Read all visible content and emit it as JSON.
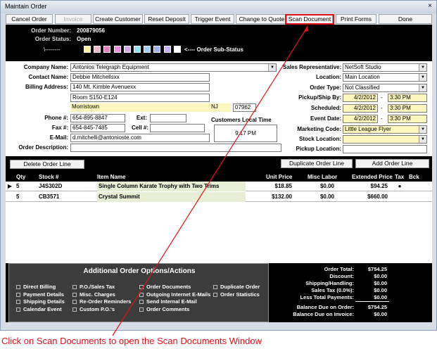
{
  "window": {
    "title": "Maintain  Order",
    "close_glyph": "×"
  },
  "toolbar": {
    "buttons": [
      "Cancel Order",
      "Invoice",
      "Create Customer",
      "Reset Deposit",
      "Trigger Event",
      "Change to Quote",
      "Scan Document",
      "Print Forms",
      "Done"
    ]
  },
  "header": {
    "order_number_label": "Order Number:",
    "order_number": "200879056",
    "order_status_label": "Order Status:",
    "order_status": "Open",
    "substatus_prefix": "\\--------",
    "substatus_label": "<---- Order Sub-Status",
    "substatus_colors": [
      "#f7f39b",
      "#f4b8c8",
      "#e880b8",
      "#f08de0",
      "#d6a8f0",
      "#8fe0f0",
      "#9ad0ff",
      "#9fb3f0",
      "#c9b2ff",
      "#ffffff"
    ]
  },
  "customer": {
    "company_name_label": "Company Name:",
    "company_name": "Antonios Telegraph Equipment",
    "contact_name_label": "Contact Name:",
    "contact_name": "Debbie Mitchellsxx",
    "billing_address_label": "Billing Address:",
    "address_line1": "140 Mt. Kimble Avenuexx",
    "address_line2": "Room S150-E124",
    "city": "Morristown",
    "state": "NJ",
    "zip": "07962",
    "phone_label": "Phone #:",
    "phone": "654-895-8847",
    "ext_label": "Ext:",
    "ext": "",
    "fax_label": "Fax #:",
    "fax": "654-845-7485",
    "cell_label": "Cell #:",
    "cell": "",
    "email_label": "E-Mail:",
    "email": "d.mitchelli@antonioste.com",
    "description_label": "Order Description:",
    "description": "",
    "local_time_label": "Customers Local Time",
    "local_time": "9:17 PM"
  },
  "order_info": {
    "sales_rep_label": "Sales Representative:",
    "sales_rep": "NetSoft Studio",
    "location_label": "Location:",
    "location": "Main Location",
    "order_type_label": "Order Type:",
    "order_type": "Not Classified",
    "pickup_label": "Pickup/Ship By:",
    "pickup_date": "4/2/2012",
    "pickup_time": "3:30 PM",
    "scheduled_label": "Scheduled:",
    "scheduled_date": "4/2/2012",
    "scheduled_time": "3:30 PM",
    "event_label": "Event Date:",
    "event_date": "4/2/2012",
    "event_time": "3:30 PM",
    "dash": "-",
    "marketing_label": "Marketing Code:",
    "marketing": "Little League Flyer",
    "stock_location_label": "Stock Location:",
    "stock_location": "",
    "pickup_location_label": "Pickup Location:",
    "pickup_location": ""
  },
  "order_lines": {
    "delete_button": "Delete Order Line",
    "duplicate_button": "Duplicate Order Line",
    "add_button": "Add Order Line",
    "columns": [
      "Qty",
      "Stock #",
      "Item Name",
      "Unit Price",
      "Misc Labor",
      "Extended Price",
      "Tax",
      "Bck"
    ],
    "rows": [
      {
        "qty": "5",
        "stock": "J4S302D",
        "item": "Single Column Karate Trophy with Two Trims",
        "unit_price": "$18.85",
        "labor": "$0.00",
        "extended": "$94.25",
        "tax": "●",
        "bck": ""
      },
      {
        "qty": "5",
        "stock": "CB3571",
        "item": "Crystal Summit",
        "unit_price": "$132.00",
        "labor": "$0.00",
        "extended": "$660.00",
        "tax": "",
        "bck": ""
      }
    ],
    "row_selector": "▶"
  },
  "options": {
    "title": "Additional Order Options/Actions",
    "col1": [
      "Direct Billing",
      "Payment Details",
      "Shipping Details",
      "Calendar Event"
    ],
    "col2": [
      "P.O./Sales Tax",
      "Misc. Charges",
      "Re-Order Reminders",
      "Custom P.O.'s"
    ],
    "col3": [
      "Order Documents",
      "Outgoing Internet E-Mails",
      "Send Internal E-Mail",
      "Order Comments"
    ],
    "col4": [
      "Duplicate Order",
      "Order Statistics"
    ]
  },
  "totals": {
    "labels": [
      "Order Total:",
      "Discount:",
      "Shipping/Handling:",
      "Sales Tax (0.0%):",
      "Less Total Payments:",
      "Balance Due on Order:",
      "Balance Due on Invoice:"
    ],
    "values": [
      "$754.25",
      "$0.00",
      "$0.00",
      "$0.00",
      "$0.00",
      "$754.25",
      "$0.00"
    ]
  },
  "callout": {
    "text": "Click on Scan Documents to open the Scan Documents Window",
    "color": "#e3101b"
  }
}
